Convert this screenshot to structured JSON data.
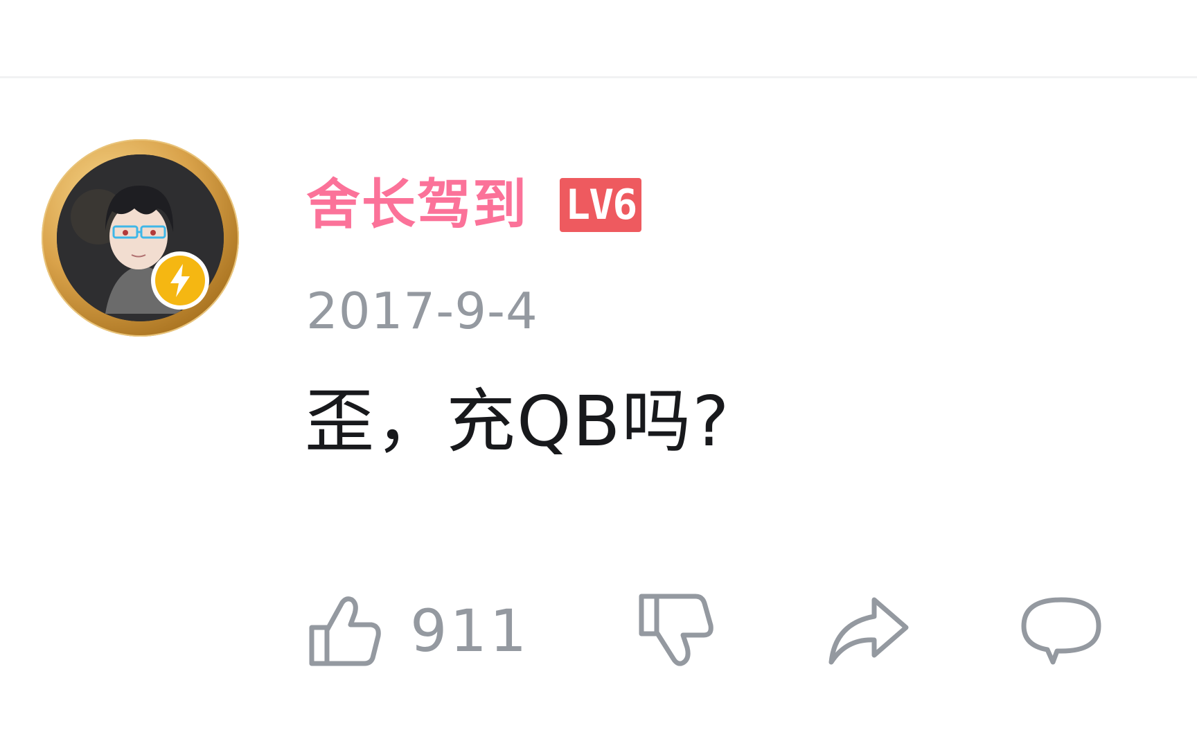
{
  "comment": {
    "user": {
      "name": "舍长驾到",
      "level": "LV6",
      "name_color": "#fb7299",
      "level_color": "#ee5a5f",
      "avatar_icon": "user-avatar",
      "badge_icon": "lightning-icon"
    },
    "date": "2017-9-4",
    "text": "歪，充QB吗?",
    "actions": {
      "like_icon": "thumbs-up-icon",
      "like_count": "911",
      "dislike_icon": "thumbs-down-icon",
      "share_icon": "share-icon",
      "reply_icon": "reply-bubble-icon"
    }
  }
}
